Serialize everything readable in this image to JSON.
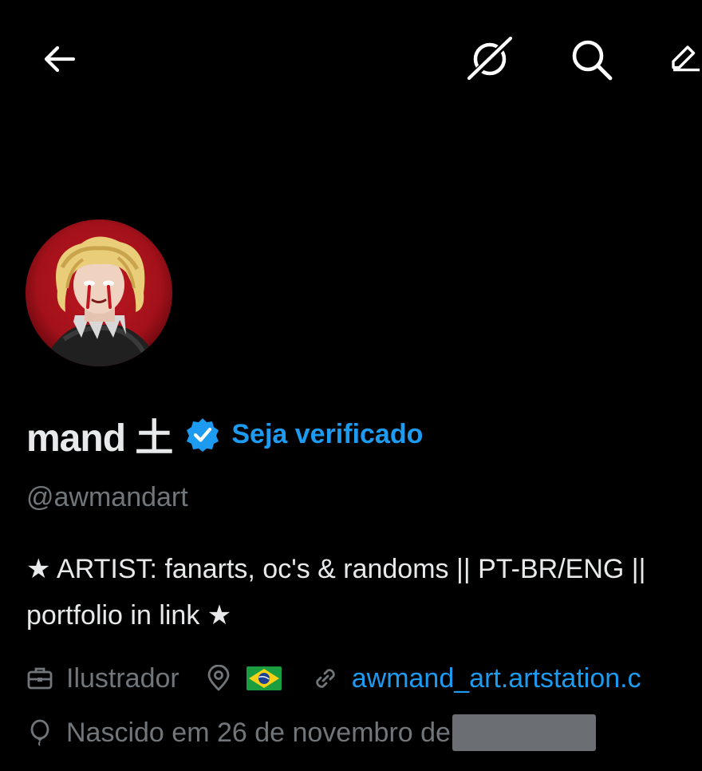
{
  "header": {
    "back_icon": "arrow-left-icon",
    "grok_icon": "grok-icon",
    "search_icon": "search-icon",
    "compose_icon": "pencil-edit-icon"
  },
  "profile": {
    "avatar_icon": "avatar",
    "display_name": "mand 土",
    "get_verified_label": "Seja verificado",
    "handle": "@awmandart",
    "bio": "★ ARTIST: fanarts, oc's & randoms || PT-BR/ENG || portfolio in link ★",
    "profession": "Ilustrador",
    "location_flag": "🇧🇷",
    "website": "awmand_art.artstation.c",
    "birthday": "Nascido em 26 de novembro de"
  },
  "colors": {
    "background": "#000000",
    "primary_text": "#e7e9ea",
    "secondary_text": "#71767b",
    "accent": "#1d9bf0",
    "avatar_red": "#b3121c"
  }
}
